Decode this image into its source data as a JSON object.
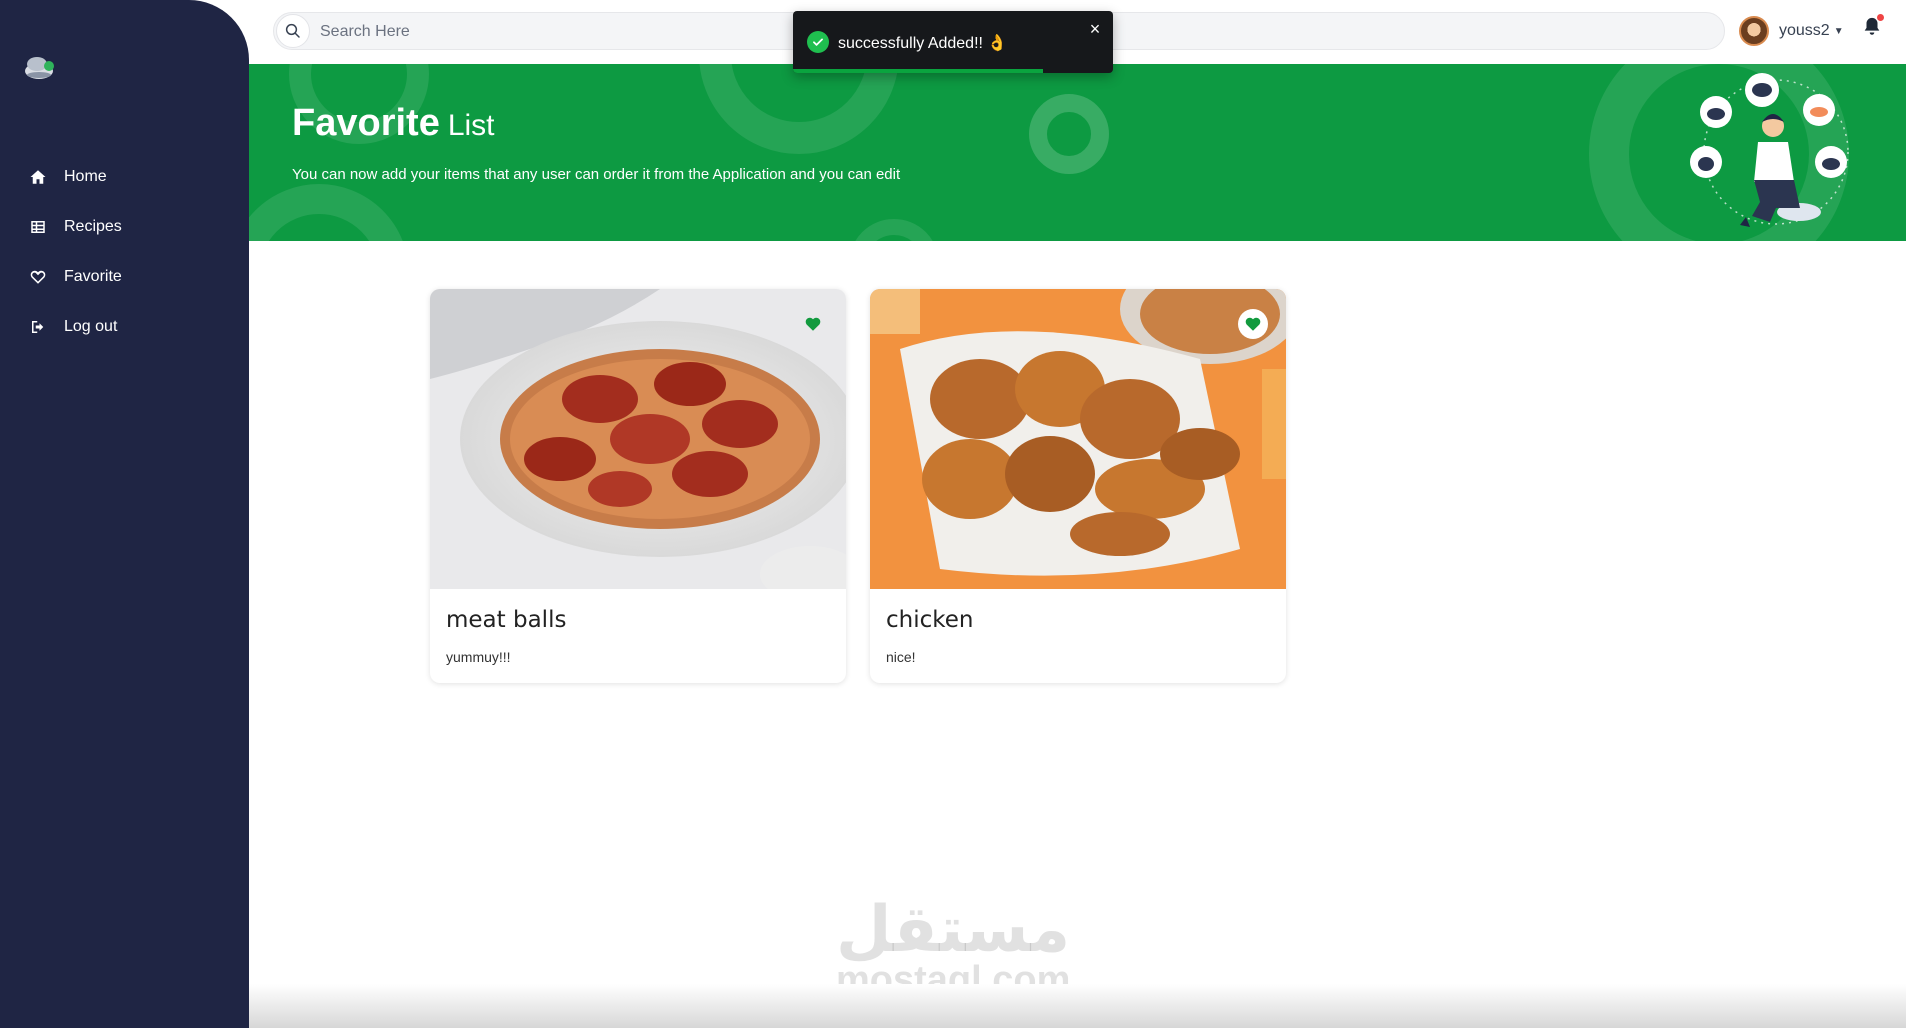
{
  "sidebar": {
    "logo_icon": "chef-hat-logo-icon",
    "items": [
      {
        "label": "Home",
        "icon": "home-icon"
      },
      {
        "label": "Recipes",
        "icon": "grid-icon"
      },
      {
        "label": "Favorite",
        "icon": "heart-outline-icon"
      },
      {
        "label": "Log out",
        "icon": "logout-icon"
      }
    ]
  },
  "topbar": {
    "search_placeholder": "Search Here",
    "username": "youss2",
    "notification_icon": "bell-icon"
  },
  "toast": {
    "message": "successfully Added!! 👌",
    "close_label": "×",
    "progress": 0.78,
    "status_color": "#1fbf4f"
  },
  "hero": {
    "title_bold": "Favorite",
    "title_light": "List",
    "subtitle": "You can now add your items that any user can order it from the Application and you can edit",
    "background_color": "#0d9a42"
  },
  "cards": [
    {
      "title": "meat balls",
      "description": "yummuy!!!",
      "favorited": true
    },
    {
      "title": "chicken",
      "description": "nice!",
      "favorited": true
    }
  ],
  "watermark": {
    "arabic": "مستقل",
    "latin": "mostaql.com"
  },
  "colors": {
    "sidebar": "#1f2544",
    "accent": "#0d9a42"
  }
}
